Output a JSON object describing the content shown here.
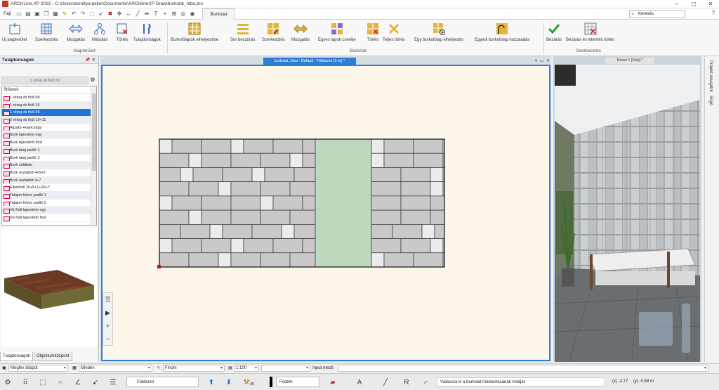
{
  "window": {
    "title": "ARCHLine.XP 2019 - C:\\Users\\dorottya.peller\\Documents\\ARCHlineXP Draw\\burkolat_hiba.pro"
  },
  "qat": {
    "file_label": "Fájl",
    "active_tab": "Burkolat",
    "search_placeholder": "Keresés",
    "help": "?"
  },
  "ribbon": {
    "groups": {
      "alap": "Alapterület",
      "burk": "Burkolat",
      "szerk": "Szerkesztés"
    },
    "buttons": [
      "Új alapterület",
      "Szerkesztés",
      "Mozgatás",
      "Másolás",
      "Törlés",
      "Tulajdonságok",
      "Burkolólapok elhelyezése",
      "Sor beszúrás",
      "Szerkesztés",
      "Mozgatás",
      "Egyes lapok cseréje",
      "Törlés",
      "Teljes törlés",
      "Egy burkolólap elhelyezés",
      "Egyedi burkolólap hozzáadás",
      "Bezárás",
      "Bezárás és kiterítés törlés"
    ]
  },
  "left": {
    "header": "Tulajdonságok",
    "selected_style": "1 réteg vb födl 30",
    "list_header": "Stílusok",
    "items": [
      "1 réteg vb födl 08",
      "1 réteg vb födl 15",
      "1 réteg vb födl 30",
      "2 réteg vb födl 19+11",
      "Aljzatb +kavicsägy",
      "Burk laposteto egy",
      "Burk lapostető ford",
      "Burk talaj padló 1",
      "Burk talaj padló 2",
      "Burk zöldteto",
      "Burk úsztatott 4+5+2",
      "Burk úsztatott 4+7",
      "Ellenfödl 15+5+1+20+7",
      "Talajon fekvo padló 1",
      "Talajon fekvo padló 2",
      "Vb födl laposteto egy",
      "Vb födl lapostetö ford"
    ],
    "tabs": [
      "Tulajdonságok",
      "Objektumközpont"
    ]
  },
  "canvas": {
    "title": "burkolat_hiba - Default - Földszint (0 m) *",
    "controls": "▾ ▭ ✕"
  },
  "view3d": {
    "title": "Nézet 1 [Kép] *"
  },
  "sidetabs": [
    "Projekt navigátor",
    "Súgó"
  ],
  "statusbar": {
    "state": "Meglév állapot",
    "filter": "Minden",
    "pen": "Finom",
    "scale": "1:100",
    "input_label": "Input mező",
    "floor": "Földszint",
    "height": "30",
    "layer": "Födém",
    "message": "Válassza ki a burkolat módosításának módját",
    "coord_x": "(x) -2.77",
    "coord_y": "(y) -0.59 m"
  },
  "colors": {
    "accent": "#2d7fd6",
    "tile": "#c9c9c9",
    "tile_light": "#ececec",
    "stripe": "#bcd8bd",
    "canvas_bg": "#fdf6eb"
  }
}
